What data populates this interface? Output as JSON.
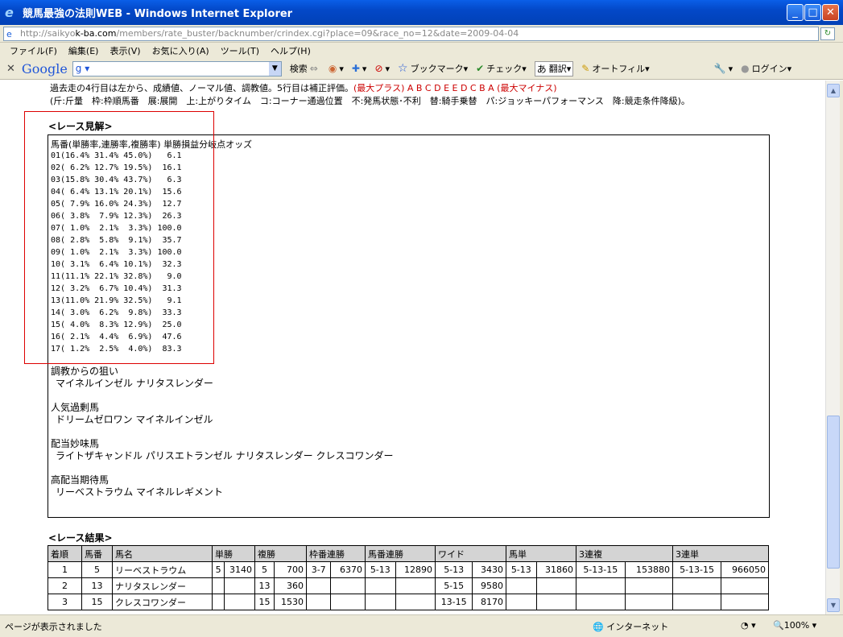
{
  "window": {
    "title": "競馬最強の法則WEB - Windows Internet Explorer",
    "url_grey": "http://saikyo",
    "url_domain": "k-ba.com",
    "url_rest": "/members/rate_buster/backnumber/crindex.cgi?place=09&race_no=12&date=2009-04-04"
  },
  "menu": [
    "ファイル(F)",
    "編集(E)",
    "表示(V)",
    "お気に入り(A)",
    "ツール(T)",
    "ヘルプ(H)"
  ],
  "toolbar": {
    "close": "✕",
    "google": "Google",
    "search": "検索",
    "bookmarks": "ブックマーク",
    "check": "チェック",
    "translate": "翻訳",
    "autofill": "オートフィル",
    "login": "ログイン"
  },
  "page": {
    "legend_line1_a": "過去走の4行目は左から、成績値、ノーマル値、調教値。5行目は補正評価。",
    "legend_line1_b": "(最大プラス) A B C D E E D C B A (最大マイナス)",
    "legend_line2": "(斤:斤量　枠:枠順馬番　展:展開　上:上がりタイム　コ:コーナー通過位置　不:発馬状態･不利　替:騎手乗替　パ:ジョッキーパフォーマンス　降:競走条件降級)。",
    "race_view_heading": "<レース見解>",
    "odds_header": "馬番(単勝率,連勝率,複勝率) 単勝損益分岐点オッズ",
    "odds_lines": [
      "01(16.4% 31.4% 45.0%)   6.1",
      "02( 6.2% 12.7% 19.5%)  16.1",
      "03(15.8% 30.4% 43.7%)   6.3",
      "04( 6.4% 13.1% 20.1%)  15.6",
      "05( 7.9% 16.0% 24.3%)  12.7",
      "06( 3.8%  7.9% 12.3%)  26.3",
      "07( 1.0%  2.1%  3.3%) 100.0",
      "08( 2.8%  5.8%  9.1%)  35.7",
      "09( 1.0%  2.1%  3.3%) 100.0",
      "10( 3.1%  6.4% 10.1%)  32.3",
      "11(11.1% 22.1% 32.8%)   9.0",
      "12( 3.2%  6.7% 10.4%)  31.3",
      "13(11.0% 21.9% 32.5%)   9.1",
      "14( 3.0%  6.2%  9.8%)  33.3",
      "15( 4.0%  8.3% 12.9%)  25.0",
      "16( 2.1%  4.4%  6.9%)  47.6",
      "17( 1.2%  2.5%  4.0%)  83.3"
    ],
    "sections": [
      {
        "label": "調教からの狙い",
        "value": "マイネルインゼル ナリタスレンダー"
      },
      {
        "label": "人気過剰馬",
        "value": "ドリームゼロワン マイネルインゼル"
      },
      {
        "label": "配当妙味馬",
        "value": "ライトザキャンドル パリスエトランゼル ナリタスレンダー クレスコワンダー"
      },
      {
        "label": "高配当期待馬",
        "value": "リーベストラウム マイネルレギメント"
      }
    ],
    "result_heading": "<レース結果>",
    "result_headers": [
      "着順",
      "馬番",
      "馬名",
      "単勝",
      "複勝",
      "枠番連勝",
      "馬番連勝",
      "ワイド",
      "馬単",
      "3連複",
      "3連単"
    ],
    "result_rows": [
      [
        "1",
        "5",
        "リーベストラウム",
        "5",
        "3140",
        "5",
        "700",
        "3-7",
        "6370",
        "5-13",
        "12890",
        "5-13",
        "3430",
        "5-13",
        "31860",
        "5-13-15",
        "153880",
        "5-13-15",
        "966050"
      ],
      [
        "2",
        "13",
        "ナリタスレンダー",
        "",
        "",
        "13",
        "360",
        "",
        "",
        "",
        "",
        "5-15",
        "9580",
        "",
        "",
        "",
        "",
        "",
        ""
      ],
      [
        "3",
        "15",
        "クレスコワンダー",
        "",
        "",
        "15",
        "1530",
        "",
        "",
        "",
        "",
        "13-15",
        "8170",
        "",
        "",
        "",
        "",
        "",
        ""
      ]
    ]
  },
  "status": {
    "left": "ページが表示されました",
    "zone": "インターネット",
    "zoom": "100%"
  }
}
